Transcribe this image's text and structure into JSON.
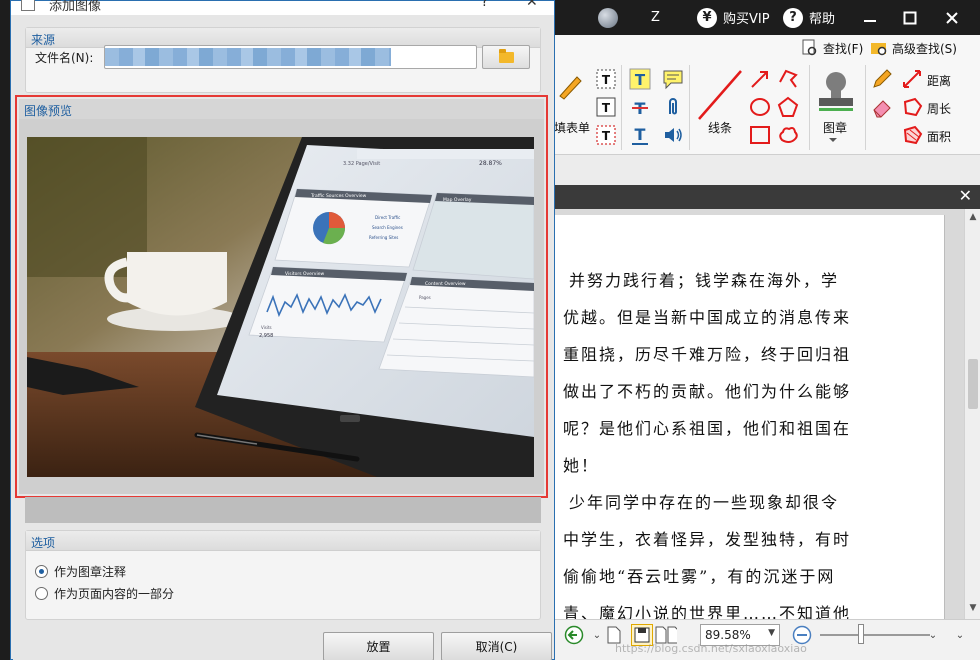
{
  "app": {
    "menu": {
      "z_label": "Z",
      "buy_vip": "购买VIP",
      "help": "帮助",
      "yen_glyph": "¥",
      "help_glyph": "?"
    },
    "ribbon": {
      "find": "查找(F)",
      "advanced_find": "高级查找(S)",
      "form": "填表单",
      "line": "线条",
      "stamp": "图章",
      "distance": "距离",
      "perimeter": "周长",
      "area": "面积"
    },
    "document": {
      "lines": [
        "并努力践行着；钱学森在海外，学",
        "优越。但是当新中国成立的消息传来",
        "重阻挠，历尽千难万险，终于回归祖",
        "做出了不朽的贡献。他们为什么能够",
        "呢？是他们心系祖国，他们和祖国在",
        "她！",
        "少年同学中存在的一些现象却很令",
        "中学生，衣着怪异，发型独特，有时",
        "偷偷地“吞云吐雾”，有的沉迷于网",
        "青、魔幻小说的世界里……不知道他"
      ]
    },
    "statusbar": {
      "zoom": "89.58%",
      "watermark": "https://blog.csdn.net/sxiaoxiaoxiao"
    }
  },
  "dialog": {
    "title": "添加图像",
    "source_group": "来源",
    "filename_label": "文件名(N):",
    "filename_value": "",
    "preview_group": "图像预览",
    "options_group": "选项",
    "option_stamp": "作为图章注释",
    "option_content": "作为页面内容的一部分",
    "selected_option": "option_stamp",
    "place_button": "放置",
    "cancel_button": "取消(C)"
  },
  "preview_image": {
    "screen_header": "3.32 Page/Visit",
    "screen_metric": "28.87%",
    "panel_traffic": "Traffic Sources Overview",
    "panel_map": "Map Overlay",
    "legend_direct": "Direct Traffic",
    "legend_search": "Search Engines",
    "legend_referring": "Referring Sites",
    "panel_visitors": "Visitors Overview",
    "visits_label": "Visits",
    "visits_value": "2,958",
    "panel_content": "Content Overview",
    "content_col": "Pages"
  },
  "colors": {
    "dark_titlebar": "#1d1d1d",
    "dialog_border": "#2a6fb0",
    "highlight": "#e53935",
    "group_heading": "#1f5fa0"
  }
}
